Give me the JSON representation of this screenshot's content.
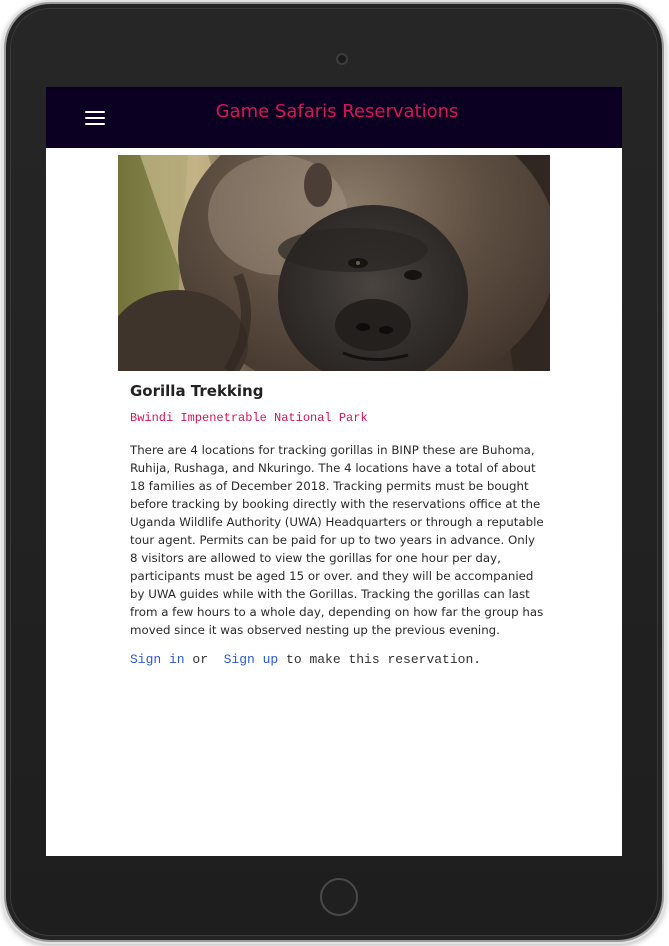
{
  "navbar": {
    "brand": "Game Safaris Reservations",
    "menu_icon": "hamburger-menu-icon"
  },
  "hero": {
    "image": "gorilla-photo"
  },
  "tour": {
    "title": "Gorilla Trekking",
    "location": "Bwindi Impenetrable National Park",
    "description": "There are 4 locations for tracking gorillas in BINP these are Buhoma, Ruhija, Rushaga, and Nkuringo. The 4 locations have a total of about 18 families as of December 2018. Tracking permits must be bought before tracking by booking directly with the reservations office at the Uganda Wildlife Authority (UWA) Headquarters or through a reputable tour agent. Permits can be paid for up to two years in advance. Only 8 visitors are allowed to view the gorillas for one hour per day, participants must be aged 15 or over. and they will be accompanied by UWA guides while with the Gorillas. Tracking the gorillas can last from a few hours to a whole day, depending on how far the group has moved since it was observed nesting up the previous evening."
  },
  "reservation": {
    "sign_in": "Sign in",
    "or": " or  ",
    "sign_up": "Sign up",
    "suffix": " to make this reservation."
  },
  "colors": {
    "navbar_bg": "#0b0021",
    "brand": "#d81555",
    "link": "#2a59d8"
  }
}
